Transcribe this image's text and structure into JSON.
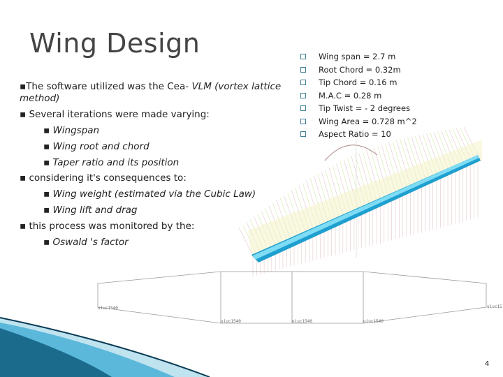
{
  "slide": {
    "title": "Wing Design",
    "bullets": {
      "b1_normal": "The software utilized was the Cea- ",
      "b1_italic": "VLM (vortex lattice",
      "b1_cont": "method)",
      "b2": "Several iterations were made varying:",
      "b2_subs": [
        "Wingspan",
        "Wing root and chord",
        "Taper ratio and its position"
      ],
      "b3": "considering it's consequences to:",
      "b3_subs": [
        "Wing weight (estimated via the Cubic Law)",
        "Wing lift and drag"
      ],
      "b4": "this process was monitored by the:",
      "b4_subs": [
        "Oswald 's factor"
      ]
    },
    "specs": [
      "Wing span = 2.7 m",
      "Root Chord = 0.32m",
      "Tip Chord = 0.16 m",
      "M.A.C = 0.28 m",
      "Tip Twist = - 2 degrees",
      "Wing Area = 0.728 m^2",
      "Aspect Ratio =  10"
    ],
    "airfoil_labels": [
      "uiuc1540",
      "uiuc1540",
      "uiuc1540",
      "uiuc1540",
      "uiuc15"
    ],
    "page_number": "4",
    "accent_color": "#3ab0d8"
  }
}
